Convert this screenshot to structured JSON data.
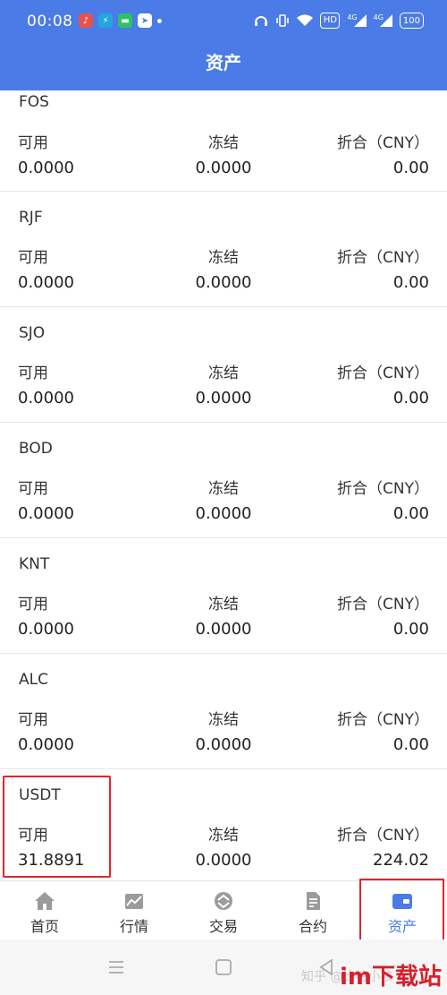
{
  "status_bar": {
    "time": "00:08",
    "signal_label_1": "4G",
    "signal_label_2": "4G",
    "battery": "100",
    "hd_label": "HD"
  },
  "header": {
    "title": "资产"
  },
  "labels": {
    "available": "可用",
    "frozen": "冻结",
    "cny": "折合（CNY）"
  },
  "assets": [
    {
      "name": "FOS",
      "available": "0.0000",
      "frozen": "0.0000",
      "cny": "0.00"
    },
    {
      "name": "RJF",
      "available": "0.0000",
      "frozen": "0.0000",
      "cny": "0.00"
    },
    {
      "name": "SJO",
      "available": "0.0000",
      "frozen": "0.0000",
      "cny": "0.00"
    },
    {
      "name": "BOD",
      "available": "0.0000",
      "frozen": "0.0000",
      "cny": "0.00"
    },
    {
      "name": "KNT",
      "available": "0.0000",
      "frozen": "0.0000",
      "cny": "0.00"
    },
    {
      "name": "ALC",
      "available": "0.0000",
      "frozen": "0.0000",
      "cny": "0.00"
    },
    {
      "name": "USDT",
      "available": "31.8891",
      "frozen": "0.0000",
      "cny": "224.02"
    }
  ],
  "tabs": [
    {
      "label": "首页",
      "icon": "home-icon"
    },
    {
      "label": "行情",
      "icon": "chart-icon"
    },
    {
      "label": "交易",
      "icon": "exchange-icon"
    },
    {
      "label": "合约",
      "icon": "contract-icon"
    },
    {
      "label": "资产",
      "icon": "wallet-icon",
      "active": true
    }
  ],
  "watermark": {
    "site": "im下载站",
    "zh": "知乎 @比特小孩"
  },
  "colors": {
    "brand": "#4a7be6",
    "highlight": "#e0262a"
  }
}
